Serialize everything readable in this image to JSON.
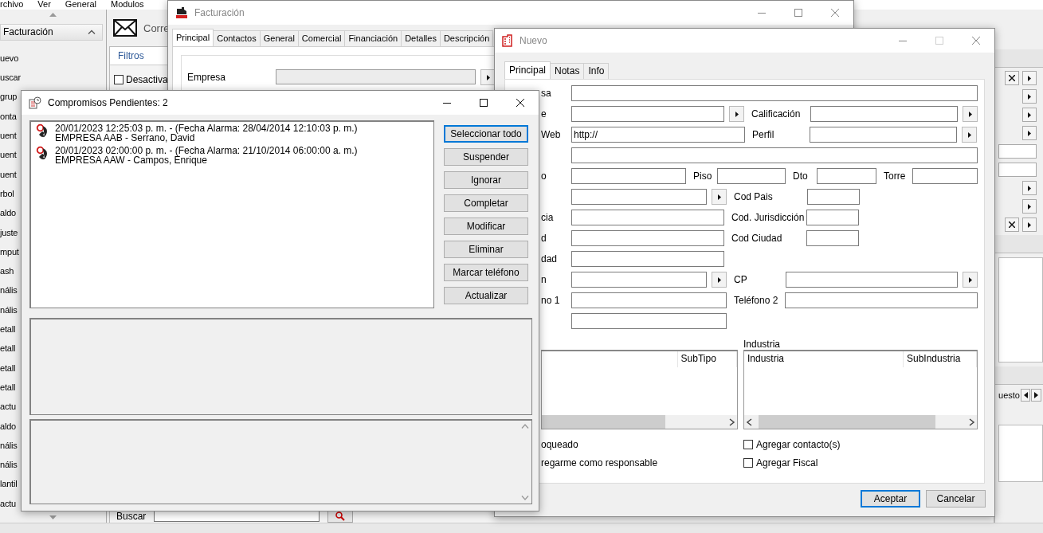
{
  "menu_bar": [
    {
      "label": "rchivo"
    },
    {
      "label": "Ver"
    },
    {
      "label": "General"
    },
    {
      "label": "Modulos"
    }
  ],
  "sidebar": {
    "title": "Facturación",
    "expanded": true,
    "items": [
      "uevo",
      "uscar",
      "grup",
      "onta",
      "uent",
      "uent",
      "uent",
      "rbol",
      "aldo",
      "juste",
      "mput",
      "ash",
      "nális",
      "nális",
      "etall",
      "etall",
      "etall",
      "etall",
      "actu",
      "aldo",
      "nális",
      "nális",
      "lantil",
      "actu"
    ]
  },
  "toolbar": {
    "label": "Corre"
  },
  "filters": {
    "title": "Filtros",
    "checkbox": {
      "label": "Desactiva",
      "checked": false
    },
    "search_label": "Buscar"
  },
  "right_panel": {
    "label": "uesto"
  },
  "facturacion_window": {
    "title": "Facturación",
    "active": false,
    "controls": [
      {
        "kind": "minimize",
        "disabled": false
      },
      {
        "kind": "maximize",
        "disabled": false
      },
      {
        "kind": "close",
        "disabled": false
      }
    ],
    "tabs": [
      {
        "label": "Principal",
        "selected": true
      },
      {
        "label": "Contactos",
        "selected": false
      },
      {
        "label": "General",
        "selected": false
      },
      {
        "label": "Comercial",
        "selected": false
      },
      {
        "label": "Financiación",
        "selected": false
      },
      {
        "label": "Detalles",
        "selected": false
      },
      {
        "label": "Descripción",
        "selected": false
      }
    ],
    "field_label": "Empresa"
  },
  "nuevo_window": {
    "title": "Nuevo",
    "active": false,
    "controls": [
      {
        "kind": "minimize",
        "disabled": false
      },
      {
        "kind": "maximize",
        "disabled": true
      },
      {
        "kind": "close",
        "disabled": false
      }
    ],
    "tabs": [
      {
        "label": "Principal",
        "selected": true
      },
      {
        "label": "Notas",
        "selected": false
      },
      {
        "label": "Info",
        "selected": false
      }
    ],
    "rows": [
      {
        "label": "sa",
        "items": [
          {
            "kind": "field"
          }
        ]
      },
      {
        "label": "e",
        "items": [
          {
            "kind": "lookup"
          },
          {
            "kind": "label",
            "text": "Calificación"
          },
          {
            "kind": "lookup"
          }
        ]
      },
      {
        "label": "Web",
        "items": [
          {
            "kind": "field",
            "value": "http://"
          },
          {
            "kind": "label",
            "text": "Perfil"
          },
          {
            "kind": "lookup"
          }
        ]
      },
      {
        "items": [
          {
            "kind": "field"
          }
        ]
      },
      {
        "label": "o",
        "items": [
          {
            "kind": "field"
          },
          {
            "kind": "label",
            "text": "Piso"
          },
          {
            "kind": "field"
          },
          {
            "kind": "label",
            "text": "Dto"
          },
          {
            "kind": "field"
          },
          {
            "kind": "label",
            "text": "Torre"
          },
          {
            "kind": "field"
          }
        ]
      },
      {
        "items": [
          {
            "kind": "lookup"
          },
          {
            "kind": "label",
            "text": "Cod Pais"
          },
          {
            "kind": "field"
          }
        ]
      },
      {
        "label": "cia",
        "items": [
          {
            "kind": "field"
          },
          {
            "kind": "label",
            "text": "Cod. Jurisdicción"
          },
          {
            "kind": "field"
          }
        ]
      },
      {
        "label": "d",
        "items": [
          {
            "kind": "field"
          },
          {
            "kind": "label",
            "text": "Cod Ciudad"
          },
          {
            "kind": "field"
          }
        ]
      },
      {
        "label": "dad",
        "items": [
          {
            "kind": "field"
          }
        ]
      },
      {
        "label": "n",
        "items": [
          {
            "kind": "lookup"
          },
          {
            "kind": "label",
            "text": "CP"
          },
          {
            "kind": "lookup"
          }
        ]
      },
      {
        "label": "no 1",
        "items": [
          {
            "kind": "field"
          },
          {
            "kind": "label",
            "text": "Teléfono 2"
          },
          {
            "kind": "field"
          }
        ]
      },
      {
        "items": [
          {
            "kind": "field"
          }
        ]
      }
    ],
    "lists": [
      {
        "columns": [
          "",
          "SubTipo"
        ]
      },
      {
        "label": "Industria",
        "columns": [
          "Industria",
          "SubIndustria"
        ]
      }
    ],
    "options": [
      {
        "kind": "text",
        "label": "oqueado"
      },
      {
        "kind": "checkbox",
        "label": "Agregar contacto(s)",
        "checked": false
      },
      {
        "kind": "text",
        "label": "regarme como responsable"
      },
      {
        "kind": "checkbox",
        "label": "Agregar Fiscal",
        "checked": false
      }
    ],
    "buttons": [
      {
        "label": "Aceptar",
        "default": true
      },
      {
        "label": "Cancelar",
        "default": false
      }
    ]
  },
  "compromisos_window": {
    "title": "Compromisos Pendientes: 2",
    "active": true,
    "controls": [
      {
        "kind": "minimize",
        "disabled": false
      },
      {
        "kind": "maximize",
        "disabled": false
      },
      {
        "kind": "close",
        "disabled": false
      }
    ],
    "items": [
      {
        "line1": "20/01/2023 12:25:03 p. m. - (Fecha Alarma: 28/04/2014 12:10:03 p. m.)",
        "line2": "EMPRESA AAB - Serrano, David"
      },
      {
        "line1": "20/01/2023 02:00:00 p. m. - (Fecha Alarma: 21/10/2014 06:00:00 a. m.)",
        "line2": "EMPRESA AAW - Campos, Enrique"
      }
    ],
    "buttons": [
      {
        "label": "Seleccionar todo",
        "focused": true
      },
      {
        "label": "Suspender",
        "focused": false
      },
      {
        "label": "Ignorar",
        "focused": false
      },
      {
        "label": "Completar",
        "focused": false
      },
      {
        "label": "Modificar",
        "focused": false
      },
      {
        "label": "Eliminar",
        "focused": false
      },
      {
        "label": "Marcar teléfono",
        "focused": false
      },
      {
        "label": "Actualizar",
        "focused": false
      }
    ]
  }
}
